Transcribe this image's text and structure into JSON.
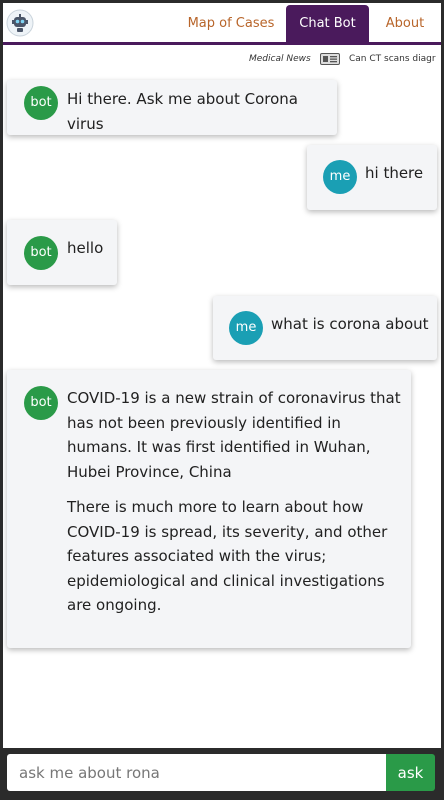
{
  "nav": {
    "tabs": [
      {
        "label": "Map of Cases",
        "active": false
      },
      {
        "label": "Chat Bot",
        "active": true
      },
      {
        "label": "About",
        "active": false
      }
    ]
  },
  "news": {
    "label": "Medical News",
    "headline": "Can CT scans diagr"
  },
  "messages": [
    {
      "sender": "bot",
      "avatar": "bot",
      "text": "Hi there. Ask me about Corona virus"
    },
    {
      "sender": "me",
      "avatar": "me",
      "text": "hi there"
    },
    {
      "sender": "bot",
      "avatar": "bot",
      "text": "hello"
    },
    {
      "sender": "me",
      "avatar": "me",
      "text": "what is corona about"
    },
    {
      "sender": "bot",
      "avatar": "bot",
      "paragraphs": [
        "COVID-19 is a new strain of coronavirus that has not been previously identified in humans. It was first identified in Wuhan, Hubei Province, China",
        "There is much more to learn about how COVID-19 is spread, its severity, and other features associated with the virus; epidemiological and clinical investigations are ongoing."
      ]
    }
  ],
  "input": {
    "placeholder": "ask me about rona",
    "value": ""
  },
  "ask_button": {
    "label": "ask"
  },
  "colors": {
    "nav_accent": "#4a1a5c",
    "nav_link": "#b8652a",
    "bot_avatar": "#2a9a48",
    "me_avatar": "#1a9fb4",
    "ask_button": "#2a9a48",
    "bubble_bg": "#f4f5f7"
  },
  "icons": {
    "logo": "robot-logo-icon",
    "news": "newspaper-icon"
  }
}
